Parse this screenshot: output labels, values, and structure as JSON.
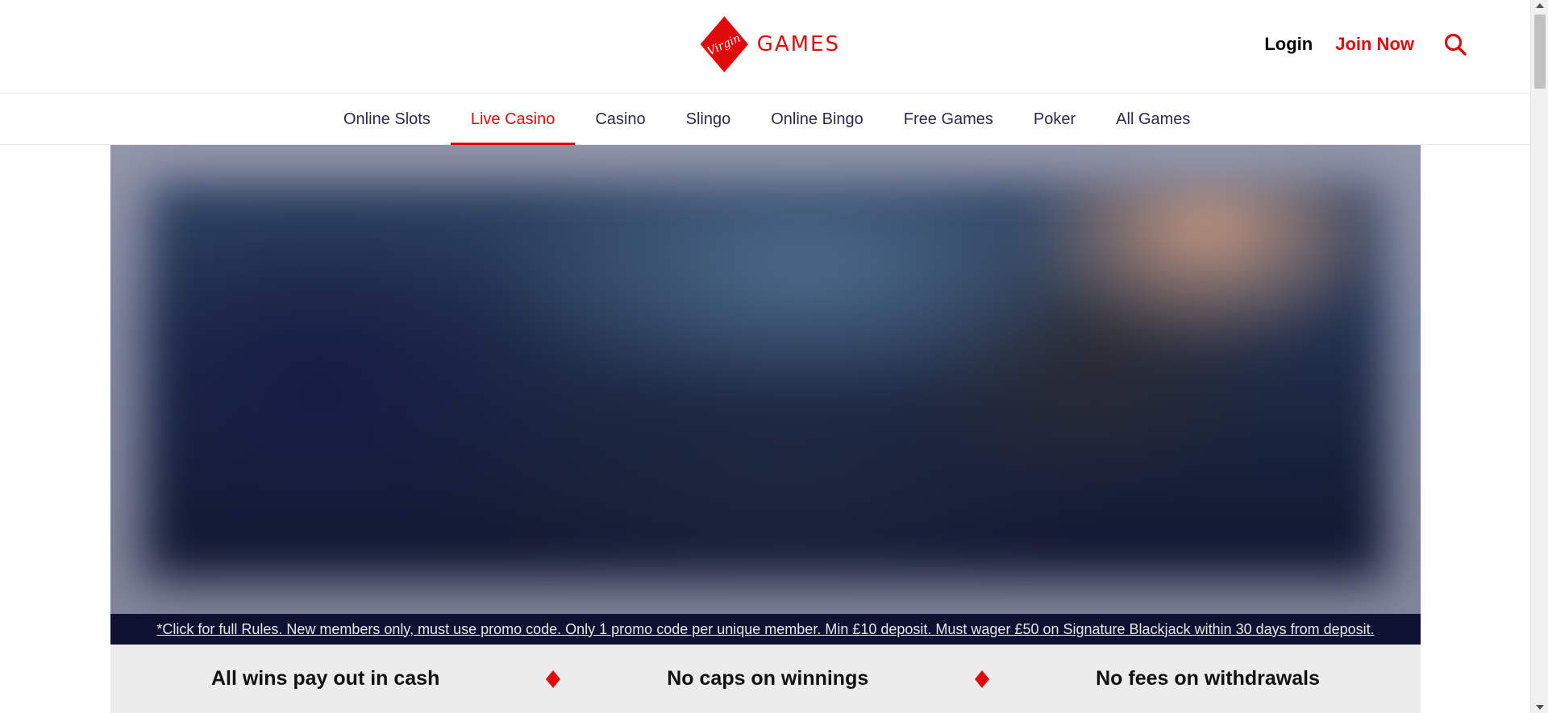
{
  "header": {
    "logo_script": "Virgin",
    "logo_text": "GAMES",
    "login_label": "Login",
    "join_label": "Join Now",
    "search_icon": "search-icon"
  },
  "nav": {
    "items": [
      {
        "label": "Online Slots",
        "active": false
      },
      {
        "label": "Live Casino",
        "active": true
      },
      {
        "label": "Casino",
        "active": false
      },
      {
        "label": "Slingo",
        "active": false
      },
      {
        "label": "Online Bingo",
        "active": false
      },
      {
        "label": "Free Games",
        "active": false
      },
      {
        "label": "Poker",
        "active": false
      },
      {
        "label": "All Games",
        "active": false
      }
    ]
  },
  "hero": {
    "terms_text": "*Click for full Rules. New members only, must use promo code. Only 1 promo code per unique member. Min £10 deposit. Must wager £50 on Signature Blackjack within 30 days from deposit."
  },
  "features": [
    "All wins pay out in cash",
    "No caps on winnings",
    "No fees on withdrawals"
  ],
  "colors": {
    "brand_red": "#e10a0a",
    "terms_bg": "#0e1230",
    "features_bg": "#ececec"
  }
}
